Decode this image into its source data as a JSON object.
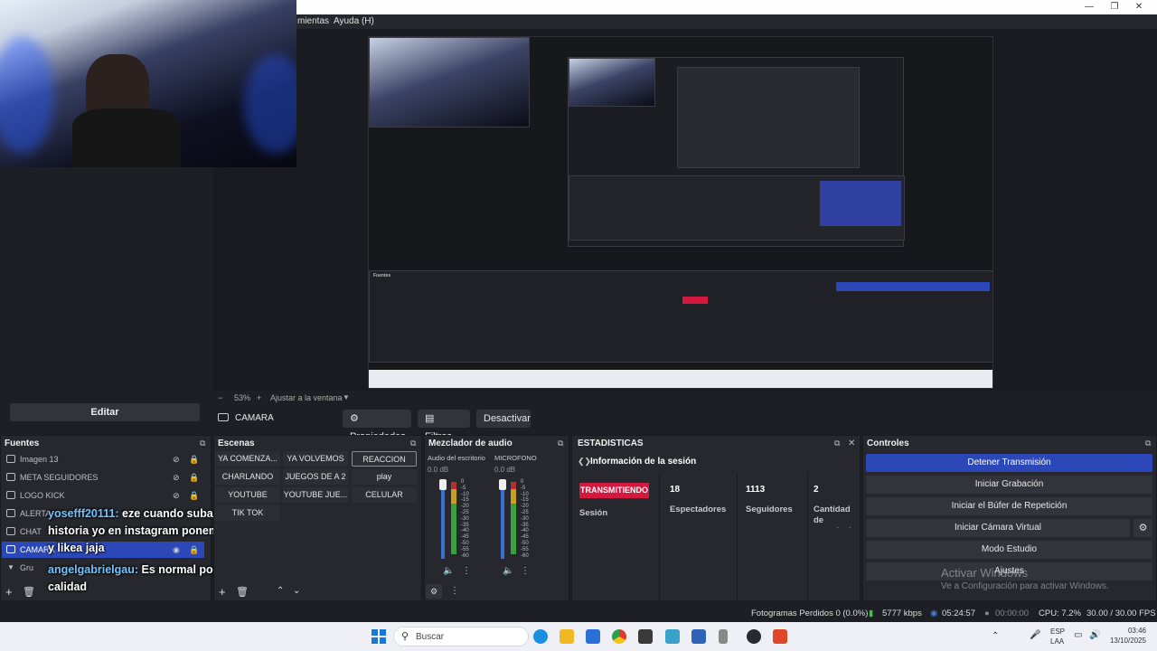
{
  "app": {
    "menu": [
      "mientas",
      "Ayuda (H)"
    ]
  },
  "preview": {
    "zoom": "53%",
    "fit_label": "Ajustar a la ventana"
  },
  "left": {
    "edit_label": "Editar"
  },
  "source_toolbar": {
    "source_name": "CAMARA",
    "properties": "Propiedades",
    "filters": "Filtros",
    "deactivate": "Desactivar"
  },
  "sources": {
    "title": "Fuentes",
    "items": [
      {
        "label": "Imagen 13"
      },
      {
        "label": "META SEGUIDORES"
      },
      {
        "label": "LOGO KICK"
      },
      {
        "label": "ALERTA"
      },
      {
        "label": "CHAT"
      },
      {
        "label": "CAMARA"
      },
      {
        "label": "Gru"
      }
    ]
  },
  "scenes": {
    "title": "Escenas",
    "items": [
      "YA COMENZA...",
      "YA VOLVEMOS",
      "REACCION",
      "CHARLANDO",
      "JUEGOS DE A 2",
      "play",
      "YOUTUBE",
      "YOUTUBE JUE...",
      "CELULAR",
      "TIK TOK"
    ]
  },
  "chat_overlay": [
    {
      "user": "yosefff20111:",
      "text": " eze cuando subas una"
    },
    {
      "user": "",
      "text": "historia yo en instagram poneme ecos"
    },
    {
      "user": "",
      "text": "y likea jaja"
    },
    {
      "user": "angelgabrielgau:",
      "text": " Es normal por la alta"
    },
    {
      "user": "",
      "text": "calidad"
    }
  ],
  "mixer": {
    "title": "Mezclador de audio",
    "channels": [
      {
        "name": "Audio del escritorio",
        "db": "0.0 dB"
      },
      {
        "name": "MICROFONO",
        "db": "0.0 dB"
      }
    ],
    "scale": [
      "0",
      "-5",
      "-10",
      "-15",
      "-20",
      "-25",
      "-30",
      "-35",
      "-40",
      "-45",
      "-50",
      "-55",
      "-60"
    ]
  },
  "stats": {
    "title": "ESTADISTICAS",
    "session_info": "Información de la sesión",
    "badge": "TRANSMITIENDO",
    "session_label": "Sesión",
    "viewers": "18",
    "viewers_label": "Espectadores",
    "followers": "1113",
    "followers_label": "Seguidores",
    "subs": "2",
    "subs_label": "Cantidad de suscripcio"
  },
  "controls": {
    "title": "Controles",
    "stop_stream": "Detener Transmisión",
    "start_recording": "Iniciar Grabación",
    "replay_buffer": "Iniciar el Búfer de Repetición",
    "virtual_cam": "Iniciar Cámara Virtual",
    "studio_mode": "Modo Estudio",
    "settings": "Ajustes"
  },
  "watermark": {
    "line1": "Activar Windows",
    "line2": "Ve a Configuración para activar Windows."
  },
  "status": {
    "dropped": "Fotogramas Perdidos 0 (0.0%)",
    "bitrate": "5777 kbps",
    "live_time": "05:24:57",
    "rec_time": "00:00:00",
    "cpu": "CPU: 7.2%",
    "fps": "30.00 / 30.00 FPS"
  },
  "taskbar": {
    "search": "Buscar",
    "lang1": "ESP",
    "lang2": "LAA",
    "time": "03:46",
    "date": "13/10/2025"
  },
  "colors": {
    "accent_blue": "#2c48b8",
    "live_red": "#d4183f"
  }
}
